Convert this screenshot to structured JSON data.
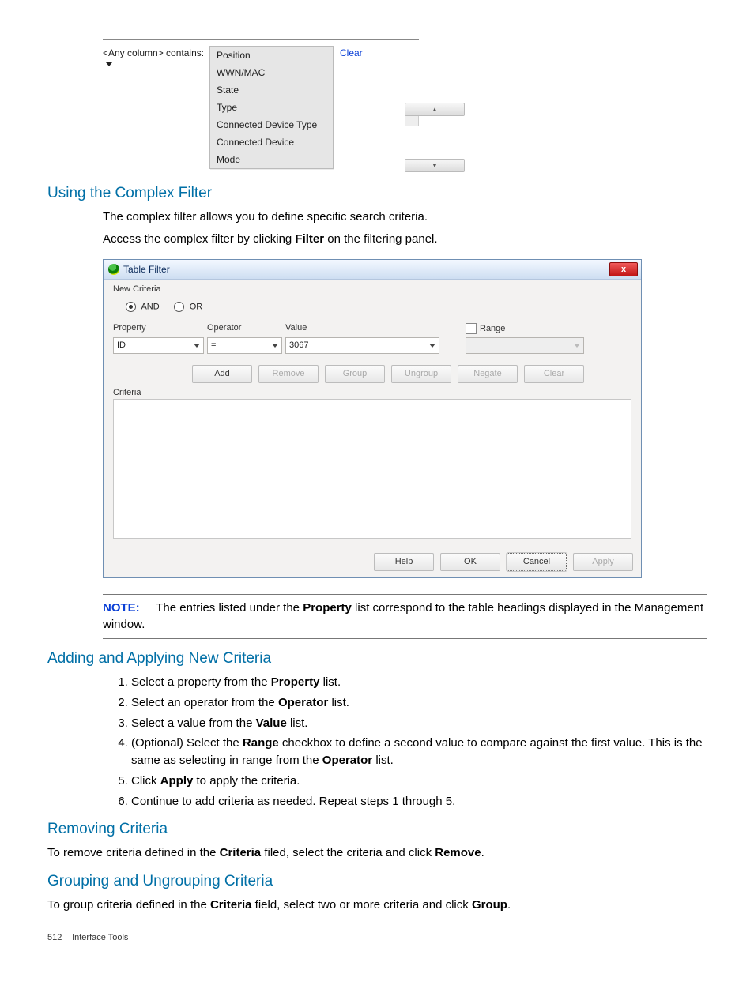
{
  "fig1": {
    "label": "<Any column> contains:",
    "clear": "Clear",
    "menu": [
      "Position",
      "WWN/MAC",
      "State",
      "Type",
      "Connected Device Type",
      "Connected Device",
      "Mode"
    ]
  },
  "headings": {
    "usingComplex": "Using the Complex Filter",
    "addingApplying": "Adding and Applying New Criteria",
    "removing": "Removing Criteria",
    "grouping": "Grouping and Ungrouping Criteria"
  },
  "body": {
    "complex1": "The complex filter allows you to define specific search criteria.",
    "complex2_a": "Access the complex filter by clicking ",
    "complex2_b": "Filter",
    "complex2_c": " on the filtering panel.",
    "removing_a": "To remove criteria defined in the ",
    "removing_b": "Criteria",
    "removing_c": " filed, select the criteria and click ",
    "removing_d": "Remove",
    "removing_e": ".",
    "grouping_a": "To group criteria defined in the ",
    "grouping_b": "Criteria",
    "grouping_c": " field, select two or more criteria and click ",
    "grouping_d": "Group",
    "grouping_e": "."
  },
  "dialog": {
    "title": "Table Filter",
    "close_glyph": "x",
    "new_criteria": "New Criteria",
    "and": "AND",
    "or": "OR",
    "hdr_property": "Property",
    "hdr_operator": "Operator",
    "hdr_value": "Value",
    "hdr_range": "Range",
    "val_property": "ID",
    "val_operator": "=",
    "val_value": "3067",
    "btn_add": "Add",
    "btn_remove": "Remove",
    "btn_group": "Group",
    "btn_ungroup": "Ungroup",
    "btn_negate": "Negate",
    "btn_clear": "Clear",
    "criteria_lbl": "Criteria",
    "footer_help": "Help",
    "footer_ok": "OK",
    "footer_cancel": "Cancel",
    "footer_apply": "Apply"
  },
  "note": {
    "label": "NOTE:",
    "text_a": "The entries listed under the ",
    "text_b": "Property",
    "text_c": " list correspond to the table headings displayed in the Management window."
  },
  "steps": {
    "s1_a": "Select a property from the ",
    "s1_b": "Property",
    "s1_c": " list.",
    "s2_a": "Select an operator from the ",
    "s2_b": "Operator",
    "s2_c": " list.",
    "s3_a": "Select a value from the ",
    "s3_b": "Value",
    "s3_c": " list.",
    "s4_a": "(Optional) Select the ",
    "s4_b": "Range",
    "s4_c": " checkbox to define a second value to compare against the first value. This is the same as selecting in range from the ",
    "s4_d": "Operator",
    "s4_e": " list.",
    "s5_a": "Click ",
    "s5_b": "Apply",
    "s5_c": " to apply the criteria.",
    "s6": "Continue to add criteria as needed. Repeat steps 1 through 5."
  },
  "footer": {
    "page": "512",
    "section": "Interface Tools"
  }
}
